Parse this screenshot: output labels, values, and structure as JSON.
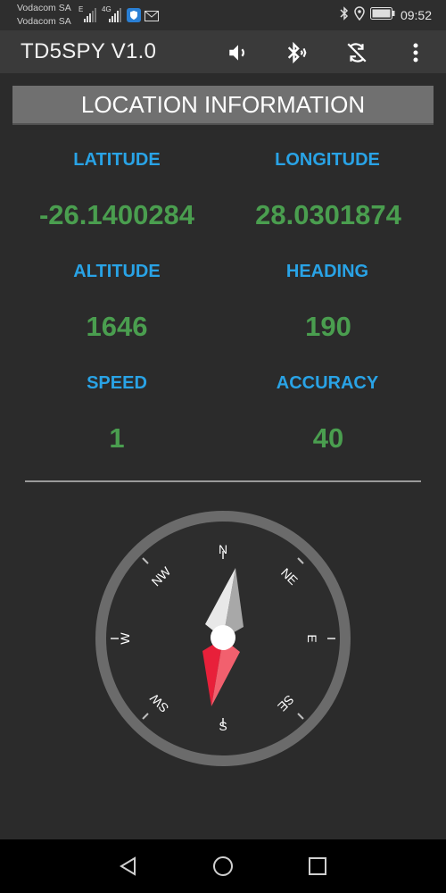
{
  "status_bar": {
    "carrier_1": "Vodacom SA",
    "carrier_2": "Vodacom SA",
    "network_1": "E",
    "network_2": "4G",
    "time": "09:52",
    "icons": [
      "signal-icon",
      "signal-icon",
      "shield-icon",
      "mail-icon",
      "bluetooth-icon",
      "location-icon",
      "battery-icon"
    ]
  },
  "app_bar": {
    "title": "TD5SPY V1.0",
    "icons": [
      "volume-icon",
      "bluetooth-audio-icon",
      "sync-disabled-icon",
      "more-vert-icon"
    ]
  },
  "section": {
    "title": "LOCATION INFORMATION"
  },
  "fields": {
    "latitude": {
      "label": "LATITUDE",
      "value": "-26.1400284"
    },
    "longitude": {
      "label": "LONGITUDE",
      "value": "28.0301874"
    },
    "altitude": {
      "label": "ALTITUDE",
      "value": "1646"
    },
    "heading": {
      "label": "HEADING",
      "value": "190"
    },
    "speed": {
      "label": "SPEED",
      "value": "1"
    },
    "accuracy": {
      "label": "ACCURACY",
      "value": "40"
    }
  },
  "compass": {
    "labels": {
      "n": "N",
      "ne": "NE",
      "e": "E",
      "se": "SE",
      "s": "S",
      "sw": "SW",
      "w": "W",
      "nw": "NW"
    },
    "heading_degrees": 190,
    "north_needle_color": "#d9d9d9",
    "south_needle_color": "#e8203a"
  },
  "nav_bar": {
    "icons": [
      "back-icon",
      "home-icon",
      "recents-icon"
    ]
  },
  "colors": {
    "label": "#29a3e6",
    "value": "#4a9e4f",
    "background": "#2b2b2b"
  }
}
